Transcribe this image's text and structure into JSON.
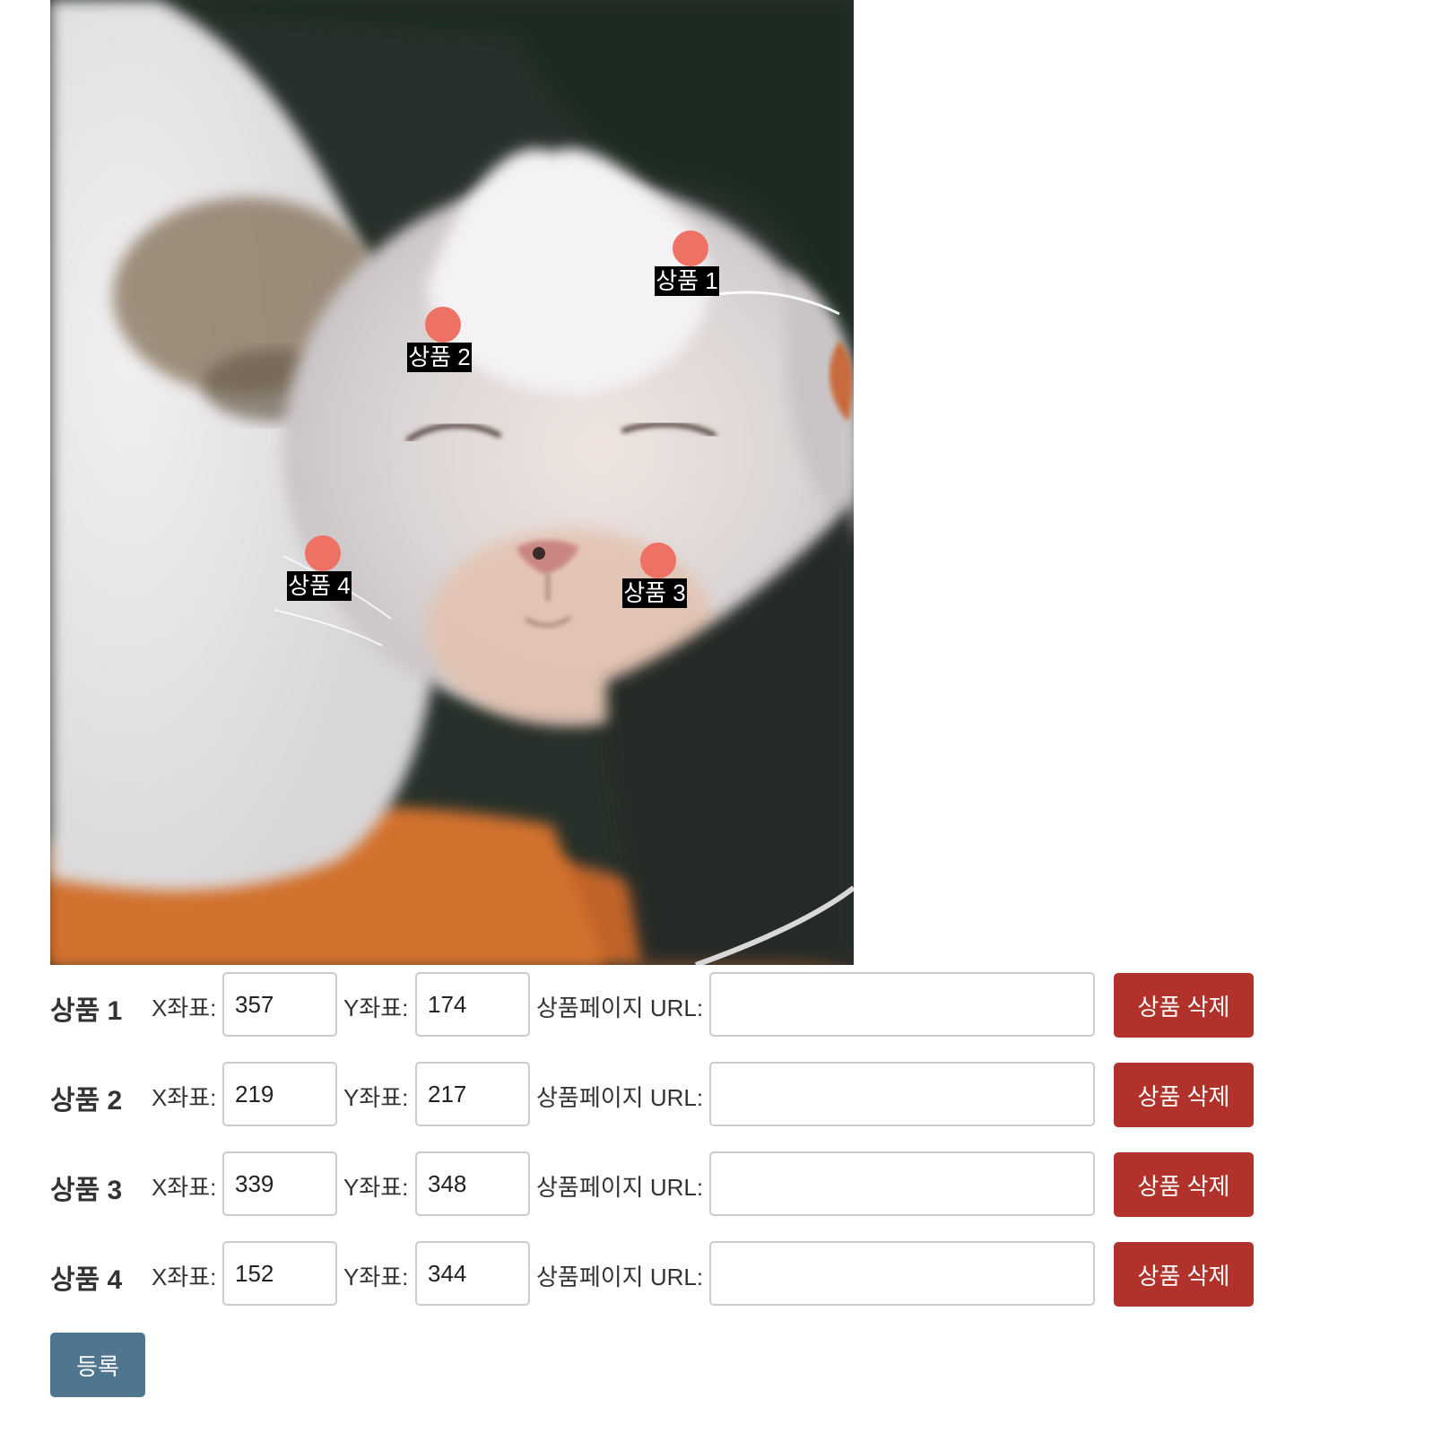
{
  "image": {
    "alt": "cat photo",
    "markers": [
      {
        "label": "상품 1"
      },
      {
        "label": "상품 2"
      },
      {
        "label": "상품 3"
      },
      {
        "label": "상품 4"
      }
    ]
  },
  "products": [
    {
      "title": "상품 1",
      "x_label": "X좌표:",
      "x_value": "357",
      "y_label": "Y좌표:",
      "y_value": "174",
      "url_label": "상품페이지 URL:",
      "url_value": "",
      "delete_label": "상품 삭제"
    },
    {
      "title": "상품 2",
      "x_label": "X좌표:",
      "x_value": "219",
      "y_label": "Y좌표:",
      "y_value": "217",
      "url_label": "상품페이지 URL:",
      "url_value": "",
      "delete_label": "상품 삭제"
    },
    {
      "title": "상품 3",
      "x_label": "X좌표:",
      "x_value": "339",
      "y_label": "Y좌표:",
      "y_value": "348",
      "url_label": "상품페이지 URL:",
      "url_value": "",
      "delete_label": "상품 삭제"
    },
    {
      "title": "상품 4",
      "x_label": "X좌표:",
      "x_value": "152",
      "y_label": "Y좌표:",
      "y_value": "344",
      "url_label": "상품페이지 URL:",
      "url_value": "",
      "delete_label": "상품 삭제"
    }
  ],
  "register_label": "등록",
  "colors": {
    "marker": "#ee7263",
    "delete_button": "#b1322a",
    "register_button": "#4f758f"
  }
}
